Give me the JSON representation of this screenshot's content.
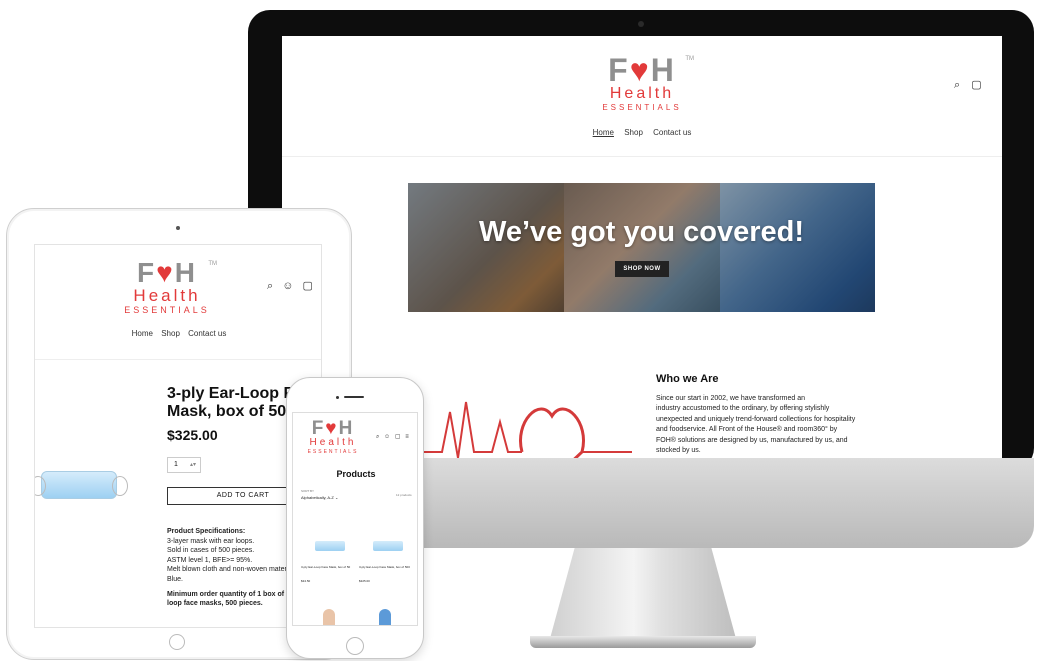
{
  "brand": {
    "foh_left": "F",
    "foh_heart": "♥",
    "foh_right": "H",
    "health": "Health",
    "essentials": "ESSENTIALS",
    "tm": "TM"
  },
  "icons": {
    "search": "search-icon",
    "account": "account-icon",
    "cart": "cart-icon",
    "menu": "hamburger-icon"
  },
  "colors": {
    "brand_red": "#e23a3a",
    "brand_gray": "#8f8f8f",
    "button_dark": "#222222"
  },
  "desktop": {
    "nav": [
      {
        "label": "Home",
        "active": true
      },
      {
        "label": "Shop"
      },
      {
        "label": "Contact us"
      }
    ],
    "hero": {
      "title": "We’ve got you covered!",
      "button": "SHOP NOW"
    },
    "about": {
      "heading": "Who we Are",
      "lines": [
        "Since our start in 2002, we have transformed an",
        "industry accustomed to the ordinary, by offering stylishly",
        "unexpected and uniquely trend-forward collections for hospitality",
        "and foodservice. All Front of the House® and room360° by",
        "FOH® solutions are designed by us, manufactured by us, and",
        "stocked by us."
      ]
    }
  },
  "tablet": {
    "nav": [
      "Home",
      "Shop",
      "Contact us"
    ],
    "product": {
      "title_line1": "3-ply Ear-Loop Fa",
      "title_line2": "Mask, box of 500",
      "price": "$325.00",
      "quantity": "1",
      "add_to_cart": "ADD TO CART",
      "spec_heading": "Product Specifications:",
      "specs": [
        "3-layer mask with ear loops.",
        "Sold in cases of 500 pieces.",
        "ASTM level 1, BFE>= 95%.",
        "Melt blown cloth and non-woven material.",
        "Blue."
      ],
      "min_line1": "Minimum order quantity of 1 box of 3-pl",
      "min_line2": "loop face masks, 500 pieces."
    }
  },
  "phone": {
    "heading": "Products",
    "sort_label": "SORT BY",
    "sort_value": "Alphabetically, A-Z",
    "count": "12 products",
    "items": [
      {
        "title": "3-ply Ear-Loop Face Mask, box of 50",
        "price": "$34.50"
      },
      {
        "title": "3-ply Ear-Loop Face Mask, box of 500",
        "price": "$325.00"
      }
    ]
  }
}
